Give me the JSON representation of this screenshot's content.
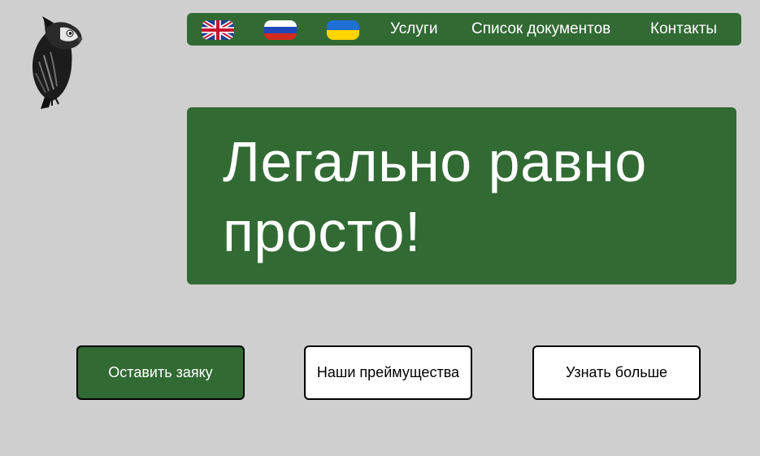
{
  "logo": {
    "icon": "owl-logo-icon"
  },
  "nav": {
    "flags": [
      {
        "icon": "flag-uk-icon"
      },
      {
        "icon": "flag-russia-icon"
      },
      {
        "icon": "flag-ukraine-icon"
      }
    ],
    "links": [
      "Услуги",
      "Список документов",
      "Контакты"
    ]
  },
  "hero": {
    "title": "Легально равно просто!"
  },
  "buttons": {
    "submit_request": "Оставить заяку",
    "advantages": "Наши преймущества",
    "learn_more": "Узнать больше"
  },
  "colors": {
    "accent_green": "#326a34",
    "page_background": "#cfcfcf",
    "button_white": "#ffffff"
  }
}
